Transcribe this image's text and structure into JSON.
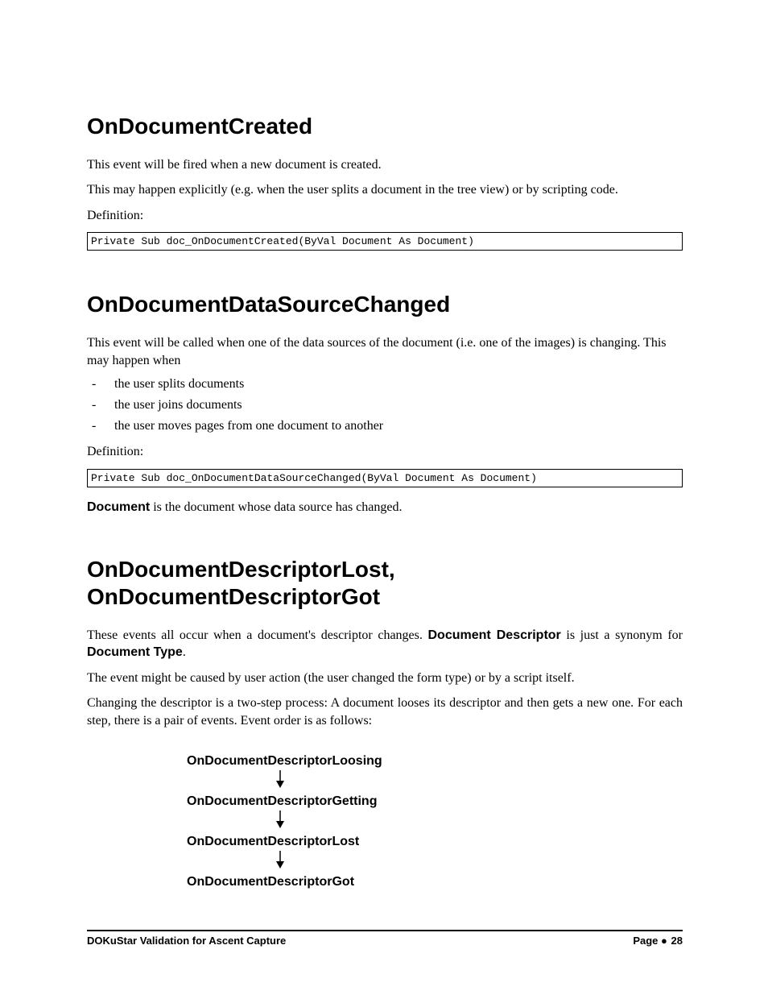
{
  "sections": [
    {
      "heading": "OnDocumentCreated",
      "p1": "This event will be fired when a new document is created.",
      "p2": "This may happen explicitly (e.g. when the user splits a document in the tree view) or by scripting code.",
      "defLabel": "Definition:",
      "code": "Private Sub doc_OnDocumentCreated(ByVal Document As Document)"
    },
    {
      "heading": "OnDocumentDataSourceChanged",
      "p1": "This event will be called when one of the data sources of the document (i.e. one of the images) is changing. This may happen when",
      "bullets": [
        "the user splits documents",
        "the user joins documents",
        "the user moves pages from one document to another"
      ],
      "defLabel": "Definition:",
      "code": "Private Sub doc_OnDocumentDataSourceChanged(ByVal Document As Document)",
      "noteBold": "Document",
      "noteRest": " is the document whose data source has changed."
    },
    {
      "heading": "OnDocumentDescriptorLost, OnDocumentDescriptorGot",
      "p1a": "These events all occur when a document's descriptor changes. ",
      "p1bold1": "Document Descriptor",
      "p1b": " is just a synonym for ",
      "p1bold2": "Document Type",
      "p1c": ".",
      "p2": "The event might be caused by user action (the user changed the form type) or by a script itself.",
      "p3": "Changing the descriptor is a two-step process: A document looses its descriptor and then gets a new one. For each step, there is a pair of events. Event order is as follows:",
      "flow": [
        "OnDocumentDescriptorLoosing",
        "OnDocumentDescriptorGetting",
        "OnDocumentDescriptorLost",
        "OnDocumentDescriptorGot"
      ]
    }
  ],
  "footer": {
    "left": "DOKuStar Validation for Ascent Capture",
    "rightLabel": "Page",
    "rightSep": "●",
    "rightNum": "28"
  }
}
